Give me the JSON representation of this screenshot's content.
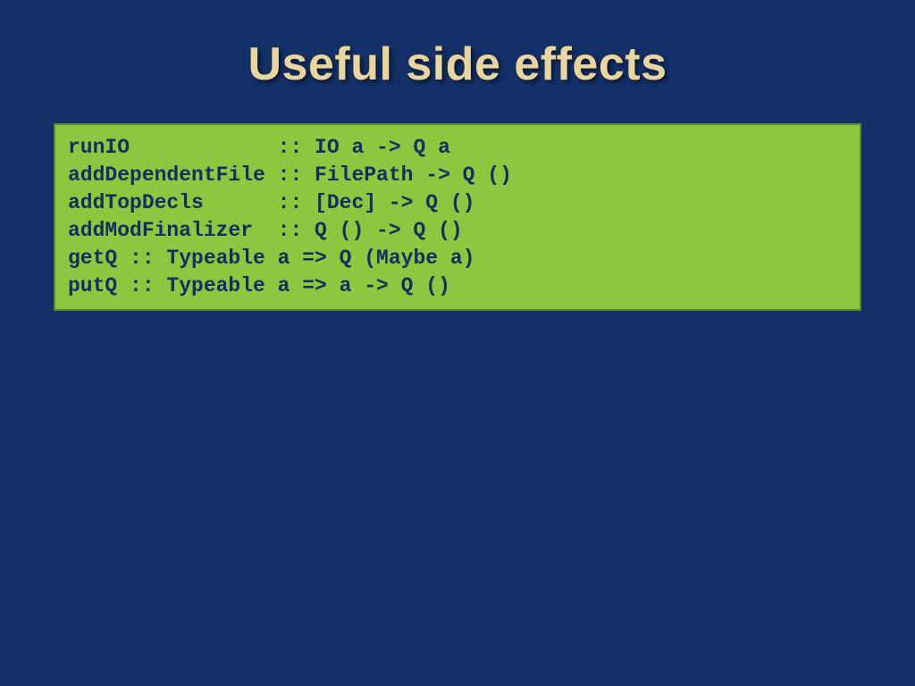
{
  "title": "Useful side effects",
  "code": {
    "line1": "runIO            :: IO a -> Q a",
    "line2": "addDependentFile :: FilePath -> Q ()",
    "line3": "addTopDecls      :: [Dec] -> Q ()",
    "line4": "addModFinalizer  :: Q () -> Q ()",
    "line5": "getQ :: Typeable a => Q (Maybe a)",
    "line6": "putQ :: Typeable a => a -> Q ()"
  }
}
